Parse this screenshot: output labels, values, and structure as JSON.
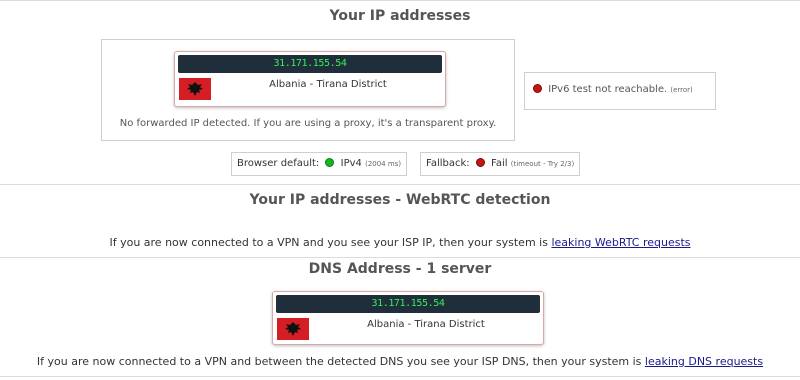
{
  "section_ip": {
    "title": "Your IP addresses",
    "ip": "31.171.155.54",
    "location": "Albania - Tirana District",
    "forwarded_note": "No forwarded IP detected. If you are using a proxy, it's a transparent proxy.",
    "ipv6_label": "IPv6 test not reachable.",
    "ipv6_status": "(error)",
    "browser_default_label": "Browser default:",
    "browser_default_value": "IPv4",
    "browser_default_time": "(2004 ms)",
    "fallback_label": "Fallback:",
    "fallback_value": "Fail",
    "fallback_detail": "(timeout - Try 2/3)"
  },
  "section_webrtc": {
    "title": "Your IP addresses - WebRTC detection",
    "text": "If you are now connected to a VPN and you see your ISP IP, then your system is",
    "link": "leaking WebRTC requests"
  },
  "section_dns": {
    "title": "DNS Address - 1 server",
    "ip": "31.171.155.54",
    "location": "Albania - Tirana District",
    "text": "If you are now connected to a VPN and between the detected DNS you see your ISP DNS, then your system is",
    "link": "leaking DNS requests"
  },
  "icons": {
    "flag": "albania-flag-icon",
    "status_ok": "green-dot-icon",
    "status_error": "red-dot-icon"
  },
  "colors": {
    "ip_bar_bg": "#1f2e3a",
    "ip_text": "#35ef5a",
    "ok": "#12b81f",
    "error": "#c71512",
    "flag_red": "#d41e24",
    "link": "#1a1a8a"
  }
}
